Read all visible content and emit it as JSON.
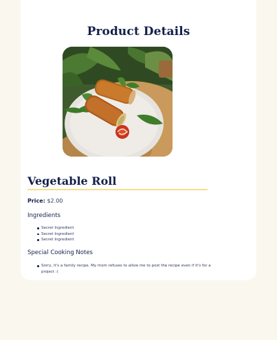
{
  "page": {
    "title": "Product Details"
  },
  "product": {
    "name": "Vegetable Roll",
    "price_label": "Price:",
    "price_value": "$2.00",
    "image_alt": "Vegetable Roll"
  },
  "ingredients": {
    "heading": "Ingredients",
    "items": [
      "Secret Ingredient",
      "Secret Ingredient",
      "Secret Ingredient"
    ]
  },
  "notes": {
    "heading": "Special Cooking Notes",
    "items": [
      "Sorry, it's a family recipe. My mom refuses to allow me to post the recipe even if it's for a project :("
    ]
  },
  "colors": {
    "background": "#faf7ee",
    "card": "#ffffff",
    "text_primary": "#14204a",
    "underline_accent": "#f6dd8f"
  }
}
